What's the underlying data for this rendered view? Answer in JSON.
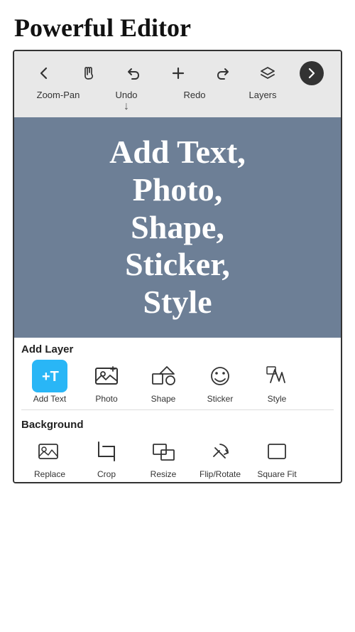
{
  "header": {
    "title": "Powerful Editor"
  },
  "toolbar": {
    "icons": [
      {
        "name": "back-icon",
        "symbol": "←"
      },
      {
        "name": "hand-icon",
        "symbol": "☜"
      },
      {
        "name": "undo-icon",
        "symbol": "↺"
      },
      {
        "name": "add-icon",
        "symbol": "+"
      },
      {
        "name": "redo-icon",
        "symbol": "↻"
      },
      {
        "name": "layers-icon",
        "symbol": "◈"
      },
      {
        "name": "next-icon",
        "symbol": "→"
      }
    ],
    "label_undo": "Undo",
    "label_redo": "Redo",
    "label_zoom": "Zoom-Pan",
    "label_layers": "Layers",
    "arrow_down": "↓"
  },
  "canvas": {
    "text": "Add Text,\nPhoto,\nShape,\nSticker,\nStyle"
  },
  "add_layer_section": {
    "title": "Add Layer",
    "items": [
      {
        "name": "add-text-tool",
        "label": "Add Text",
        "icon_type": "add-text"
      },
      {
        "name": "photo-tool",
        "label": "Photo",
        "icon_type": "photo"
      },
      {
        "name": "shape-tool",
        "label": "Shape",
        "icon_type": "shape"
      },
      {
        "name": "sticker-tool",
        "label": "Sticker",
        "icon_type": "sticker"
      },
      {
        "name": "style-tool",
        "label": "Style",
        "icon_type": "style"
      }
    ]
  },
  "background_section": {
    "title": "Background",
    "items": [
      {
        "name": "replace-tool",
        "label": "Replace",
        "icon_type": "replace"
      },
      {
        "name": "crop-tool",
        "label": "Crop",
        "icon_type": "crop"
      },
      {
        "name": "resize-tool",
        "label": "Resize",
        "icon_type": "resize"
      },
      {
        "name": "flip-rotate-tool",
        "label": "Flip/Rotate",
        "icon_type": "flip-rotate"
      },
      {
        "name": "square-fit-tool",
        "label": "Square Fit",
        "icon_type": "square-fit"
      }
    ]
  }
}
